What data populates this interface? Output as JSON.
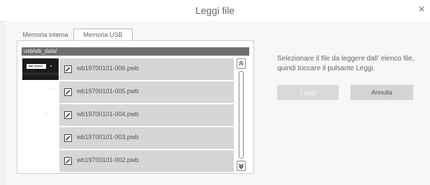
{
  "window": {
    "title": "Leggi file",
    "close_glyph": "×"
  },
  "tabs": [
    {
      "label": "Memoria interna",
      "selected": false
    },
    {
      "label": "Memoria USB",
      "selected": true
    }
  ],
  "path": "usb/wb_data/",
  "files": [
    {
      "name": "wb19700101-006.pwb",
      "checked": true,
      "thumbnail": "dark"
    },
    {
      "name": "wb19700101-005.pwb",
      "checked": true,
      "thumbnail": "blank"
    },
    {
      "name": "wb19700101-004.pwb",
      "checked": true,
      "thumbnail": "blank"
    },
    {
      "name": "wb19700101-003.pwb",
      "checked": true,
      "thumbnail": "blank"
    },
    {
      "name": "wb19700101-002.pwb",
      "checked": true,
      "thumbnail": "blank"
    }
  ],
  "scroll": {
    "up_glyph": "«",
    "down_glyph": "»"
  },
  "instructions": "Selezionare il file da leggere dall’ elenco file, quindi toccare il pulsante Leggi.",
  "buttons": {
    "read": "Leggi",
    "cancel": "Annulla"
  }
}
